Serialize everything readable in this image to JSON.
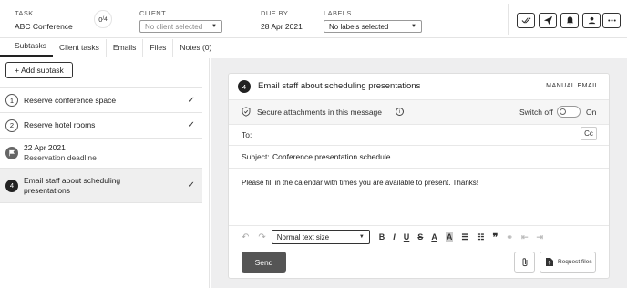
{
  "header": {
    "task_caption": "TASK",
    "task_value": "ABC Conference",
    "progress_value": "0",
    "progress_total": "4",
    "client_caption": "CLIENT",
    "client_placeholder": "No client selected",
    "due_caption": "DUE BY",
    "due_value": "28 Apr 2021",
    "labels_caption": "LABELS",
    "labels_value": "No labels selected",
    "action_icons": [
      "double-check-icon",
      "send-icon",
      "bell-icon",
      "user-add-icon",
      "more-icon"
    ]
  },
  "tabs": [
    {
      "label": "Subtasks",
      "active": true
    },
    {
      "label": "Client tasks",
      "active": false
    },
    {
      "label": "Emails",
      "active": false
    },
    {
      "label": "Files",
      "active": false
    },
    {
      "label": "Notes (0)",
      "active": false
    }
  ],
  "subtasks": {
    "add_label": "+ Add subtask",
    "items": [
      {
        "num": "1",
        "text": "Reserve conference space",
        "checked": true
      },
      {
        "num": "2",
        "text": "Reserve hotel rooms",
        "checked": true
      },
      {
        "date": "22 Apr 2021",
        "text": "Reservation deadline",
        "type": "deadline"
      },
      {
        "num": "4",
        "text": "Email staff about scheduling",
        "text2": "presentations",
        "checked": true,
        "selected": true
      }
    ]
  },
  "email": {
    "number": "4",
    "title": "Email staff about scheduling presentations",
    "badge": "MANUAL EMAIL",
    "secure_label": "Secure attachments in this message",
    "switch_off": "Switch off",
    "switch_on": "On",
    "to_label": "To:",
    "cc_label": "Cc",
    "subject_label": "Subject:",
    "subject_value": "Conference presentation schedule",
    "body": "Please fill in the calendar with times you are available to present. Thanks!",
    "text_size": "Normal text size",
    "send_label": "Send",
    "request_files": "Request files"
  }
}
